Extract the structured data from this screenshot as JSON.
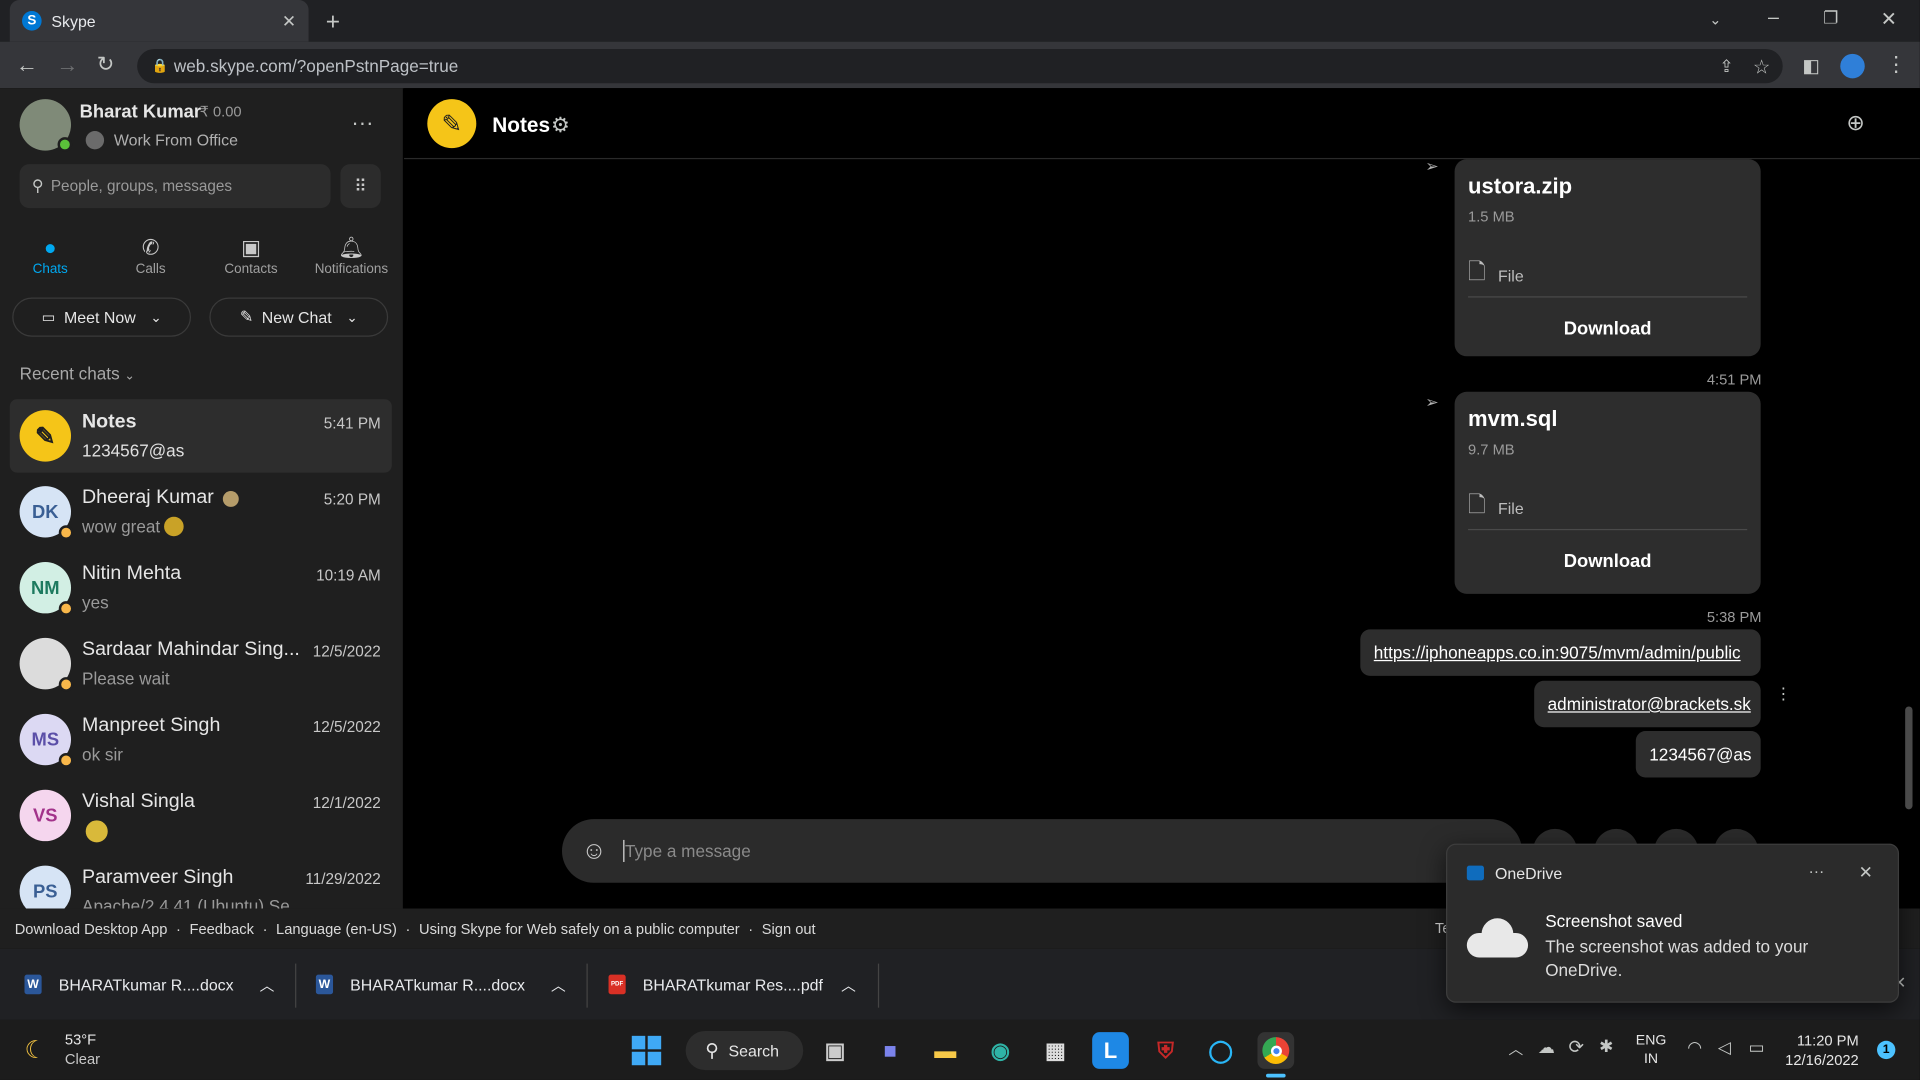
{
  "browser": {
    "tab_title": "Skype",
    "url": "web.skype.com/?openPstnPage=true"
  },
  "profile": {
    "name": "Bharat Kumar",
    "credit": "₹ 0.00",
    "status": "Work From Office"
  },
  "search": {
    "placeholder": "People, groups, messages"
  },
  "nav": [
    {
      "label": "Chats"
    },
    {
      "label": "Calls"
    },
    {
      "label": "Contacts"
    },
    {
      "label": "Notifications"
    }
  ],
  "actions": {
    "meet_now": "Meet Now",
    "new_chat": "New Chat"
  },
  "recent_chats_label": "Recent chats",
  "chats": [
    {
      "initials": "",
      "name": "Notes",
      "preview": "1234567@as",
      "time": "5:41 PM"
    },
    {
      "initials": "DK",
      "name": "Dheeraj Kumar",
      "preview": "wow great",
      "time": "5:20 PM"
    },
    {
      "initials": "NM",
      "name": "Nitin Mehta",
      "preview": "yes",
      "time": "10:19 AM"
    },
    {
      "initials": "",
      "name": "Sardaar Mahindar Sing...",
      "preview": "Please wait",
      "time": "12/5/2022"
    },
    {
      "initials": "MS",
      "name": "Manpreet Singh",
      "preview": "ok sir",
      "time": "12/5/2022"
    },
    {
      "initials": "VS",
      "name": "Vishal Singla",
      "preview": "",
      "time": "12/1/2022"
    },
    {
      "initials": "PS",
      "name": "Paramveer Singh",
      "preview": "Apache/2.4.41 (Ubuntu) Se",
      "time": "11/29/2022"
    }
  ],
  "conversation": {
    "title": "Notes",
    "files": [
      {
        "name": "ustora.zip",
        "size": "1.5 MB",
        "type": "File",
        "action": "Download"
      },
      {
        "name": "mvm.sql",
        "size": "9.7 MB",
        "type": "File",
        "action": "Download"
      }
    ],
    "timestamps": [
      "4:51 PM",
      "5:38 PM"
    ],
    "messages": [
      "https://iphoneapps.co.in:9075/mvm/admin/public",
      "administrator@brackets.sk",
      "1234567@as"
    ],
    "composer_placeholder": "Type a message"
  },
  "footer": {
    "download_app": "Download Desktop App",
    "feedback": "Feedback",
    "language": "Language (en-US)",
    "safety": "Using Skype for Web safely on a public computer",
    "sign_out": "Sign out",
    "dot": "·",
    "partial": "Te"
  },
  "downloads": [
    {
      "name": "BHARATkumar R....docx",
      "kind": "W"
    },
    {
      "name": "BHARATkumar R....docx",
      "kind": "W"
    },
    {
      "name": "BHARATkumar Res....pdf",
      "kind": "PDF"
    }
  ],
  "toast": {
    "app": "OneDrive",
    "title": "Screenshot saved",
    "body": "The screenshot was added to your OneDrive.",
    "more": "···"
  },
  "taskbar": {
    "weather_temp": "53°F",
    "weather_desc": "Clear",
    "search_label": "Search",
    "lang_line1": "ENG",
    "lang_line2": "IN",
    "time": "11:20 PM",
    "date": "12/16/2022",
    "badge": "1"
  },
  "colors": {
    "accent": "#00a8f0",
    "presence_away": "#f8b74a",
    "presence_online": "#5bbf3a",
    "notes_yellow": "#f5c518"
  }
}
